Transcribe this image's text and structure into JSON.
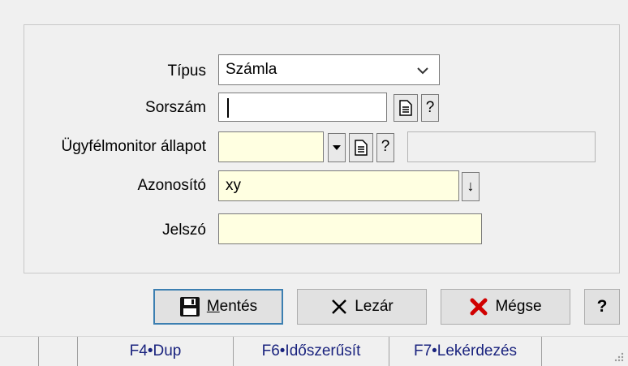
{
  "form": {
    "tipus_label": "Típus",
    "tipus_value": "Számla",
    "sorszam_label": "Sorszám",
    "sorszam_value": "",
    "ugyfelmonitor_label": "Ügyfélmonitor állapot",
    "ugyfelmonitor_value": "",
    "ugyfelmonitor_desc": "",
    "azonosito_label": "Azonosító",
    "azonosito_value": "xy",
    "jelszo_label": "Jelszó",
    "jelszo_value": "",
    "help_glyph": "?",
    "down_arrow": "↓",
    "dropdown_glyph": "▾"
  },
  "buttons": {
    "save_mnemonic": "M",
    "save_rest": "entés",
    "close": "Lezár",
    "cancel": "Mégse",
    "help": "?"
  },
  "statusbar": {
    "items": [
      "F4•Dup",
      "F6•Időszerűsít",
      "F7•Lekérdezés"
    ]
  },
  "colors": {
    "accent": "#3c7fb1",
    "input_yellow": "#ffffe1",
    "cancel_red": "#d00000",
    "status_text": "#1a237e"
  }
}
